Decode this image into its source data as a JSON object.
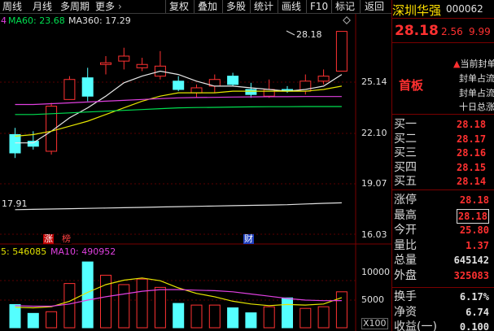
{
  "toolbar": {
    "left_tabs": [
      "周线",
      "月线",
      "多周期",
      "更多"
    ],
    "more_arrow": "›",
    "right_buttons": [
      "复权",
      "叠加",
      "多股",
      "统计",
      "画线",
      "F10",
      "标记",
      "返回"
    ]
  },
  "indicators": {
    "ma_items": [
      {
        "label": "MA60: 23.68",
        "color": "#00e050"
      },
      {
        "label": "MA360: 17.29",
        "color": "#e0e0e0"
      }
    ],
    "left_marker": "4",
    "volume_items": [
      {
        "label": "5: 546085",
        "color": "#e0e000"
      },
      {
        "label": "MA10: 490952",
        "color": "#e040e0"
      }
    ]
  },
  "price_axis": [
    "25.14",
    "22.10",
    "19.07",
    "16.03"
  ],
  "volume_axis": [
    "10000",
    "5000"
  ],
  "volume_unit": "X100",
  "annotations": {
    "high_price": "28.18",
    "ma360_value": "17.91",
    "event_tags": [
      {
        "text": "涨",
        "color": "#ffffff",
        "bg": "#c00000"
      },
      {
        "text": "榜",
        "color": "#ff4040",
        "bg": "#000000"
      },
      {
        "text": "财",
        "color": "#ffffff",
        "bg": "#2040c0"
      }
    ]
  },
  "chart_data": {
    "type": "candlestick",
    "price_ylim": [
      16.03,
      28.6
    ],
    "candles": [
      {
        "o": 22.0,
        "c": 20.9,
        "h": 22.4,
        "l": 20.6
      },
      {
        "o": 21.6,
        "c": 21.3,
        "h": 22.2,
        "l": 21.1
      },
      {
        "o": 21.0,
        "c": 23.7,
        "h": 23.9,
        "l": 20.8
      },
      {
        "o": 24.1,
        "c": 25.3,
        "h": 25.5,
        "l": 24.1
      },
      {
        "o": 25.4,
        "c": 24.3,
        "h": 26.0,
        "l": 24.0
      },
      {
        "o": 26.2,
        "c": 26.3,
        "h": 26.7,
        "l": 25.6
      },
      {
        "o": 26.4,
        "c": 26.7,
        "h": 27.2,
        "l": 25.9
      },
      {
        "o": 26.0,
        "c": 26.2,
        "h": 26.6,
        "l": 25.8
      },
      {
        "o": 25.5,
        "c": 26.1,
        "h": 27.0,
        "l": 25.3
      },
      {
        "o": 25.2,
        "c": 24.7,
        "h": 25.5,
        "l": 24.6
      },
      {
        "o": 24.5,
        "c": 24.8,
        "h": 25.0,
        "l": 24.2
      },
      {
        "o": 24.9,
        "c": 25.3,
        "h": 25.6,
        "l": 24.5
      },
      {
        "o": 25.5,
        "c": 25.0,
        "h": 25.7,
        "l": 24.9
      },
      {
        "o": 24.7,
        "c": 24.4,
        "h": 25.1,
        "l": 24.2
      },
      {
        "o": 24.3,
        "c": 24.7,
        "h": 25.3,
        "l": 24.2
      },
      {
        "o": 24.7,
        "c": 24.6,
        "h": 24.9,
        "l": 24.5
      },
      {
        "o": 24.6,
        "c": 25.2,
        "h": 25.6,
        "l": 24.4
      },
      {
        "o": 25.2,
        "c": 25.5,
        "h": 25.9,
        "l": 25.0
      },
      {
        "o": 25.8,
        "c": 28.18,
        "h": 28.18,
        "l": 25.8
      }
    ],
    "ma_short": [
      21.5,
      21.5,
      22.2,
      23.0,
      23.6,
      24.3,
      25.1,
      25.5,
      25.8,
      25.6,
      25.2,
      24.9,
      24.9,
      24.8,
      24.7,
      24.6,
      24.7,
      24.9,
      25.6
    ],
    "ma_mid": [
      21.9,
      22.0,
      22.2,
      22.5,
      22.8,
      23.2,
      23.6,
      24.0,
      24.3,
      24.5,
      24.5,
      24.5,
      24.6,
      24.6,
      24.6,
      24.6,
      24.6,
      24.7,
      24.9
    ],
    "ma_long": [
      23.2,
      23.2,
      23.25,
      23.3,
      23.35,
      23.4,
      23.45,
      23.5,
      23.55,
      23.6,
      23.62,
      23.63,
      23.65,
      23.66,
      23.67,
      23.67,
      23.68,
      23.68,
      23.68
    ],
    "ma360": [
      17.5,
      17.52,
      17.54,
      17.56,
      17.58,
      17.6,
      17.62,
      17.64,
      17.66,
      17.68,
      17.7,
      17.72,
      17.74,
      17.76,
      17.78,
      17.8,
      17.84,
      17.88,
      17.91
    ],
    "volume_ylim": [
      0,
      12000
    ],
    "volumes": [
      4200,
      2600,
      2900,
      8000,
      11900,
      9500,
      7800,
      8800,
      7300,
      4400,
      4100,
      4100,
      3600,
      2700,
      3800,
      5400,
      3500,
      3800,
      6500
    ],
    "vol_ma5": [
      3700,
      3600,
      3800,
      4800,
      6400,
      7800,
      8600,
      9000,
      8500,
      7200,
      6200,
      5600,
      4800,
      4300,
      4000,
      4200,
      4100,
      4300,
      5460
    ],
    "vol_ma10": [
      4000,
      3900,
      3900,
      4300,
      5000,
      5600,
      6100,
      6600,
      6900,
      6900,
      6800,
      6700,
      6500,
      6100,
      5700,
      5300,
      5000,
      4900,
      4910
    ]
  },
  "quote": {
    "name": "深圳华强",
    "code": "000062",
    "price": "28.18",
    "change": "2.56",
    "change_pct": "9.99",
    "board_label": "首板",
    "notes": [
      "当前封单",
      "封单占流",
      "封单占流",
      "十日总涨"
    ],
    "bids": [
      {
        "label": "买一",
        "price": "28.18"
      },
      {
        "label": "买二",
        "price": "28.17"
      },
      {
        "label": "买三",
        "price": "28.16"
      },
      {
        "label": "买四",
        "price": "28.15"
      },
      {
        "label": "买五",
        "price": "28.14"
      }
    ],
    "stats_a": [
      {
        "label": "涨停",
        "value": "28.18",
        "color": "#ff3030",
        "boxed": false
      },
      {
        "label": "最高",
        "value": "28.18",
        "color": "#ff3030",
        "boxed": true
      },
      {
        "label": "今开",
        "value": "25.80",
        "color": "#ff3030",
        "boxed": false
      },
      {
        "label": "量比",
        "value": "1.37",
        "color": "#ff3030",
        "boxed": false
      },
      {
        "label": "总量",
        "value": "645142",
        "color": "#e0e0e0",
        "boxed": false
      },
      {
        "label": "外盘",
        "value": "325083",
        "color": "#ff3030",
        "boxed": false
      }
    ],
    "stats_b": [
      {
        "label": "换手",
        "value": "6.17%",
        "color": "#e0e0e0"
      },
      {
        "label": "净资",
        "value": "6.74",
        "color": "#e0e0e0"
      },
      {
        "label": "收益(一)",
        "value": "0.100",
        "color": "#e0e0e0"
      }
    ]
  }
}
